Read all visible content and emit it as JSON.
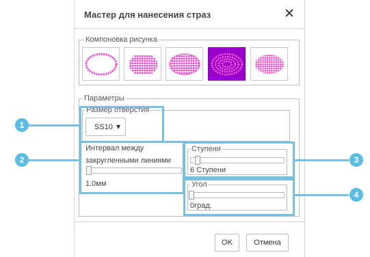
{
  "dialog": {
    "title": "Мастер для нанесения страз",
    "close_label": "✕"
  },
  "layout_group": {
    "legend": "Компоновка рисунка",
    "selected_index": 3,
    "thumbnails": [
      {
        "name": "outline-oval"
      },
      {
        "name": "filled-rounded"
      },
      {
        "name": "filled-oval-offset"
      },
      {
        "name": "concentric-oval"
      },
      {
        "name": "filled-oval-dense"
      }
    ]
  },
  "params_group": {
    "legend": "Параметры",
    "hole_size": {
      "legend": "Размер отверстия",
      "selected": "SS10"
    },
    "interval": {
      "label_line1": "Интервал между",
      "label_line2": "закругленными линиями",
      "value_text": "1.0мм"
    },
    "steps": {
      "legend": "Ступени",
      "value_text": "6 Ступени"
    },
    "angle": {
      "legend": "Угол",
      "value_text": "0град."
    }
  },
  "callouts": [
    "1",
    "2",
    "3",
    "4"
  ],
  "buttons": {
    "ok": "OK",
    "cancel": "Отмена"
  },
  "colors": {
    "accent_callout": "#73c2e3",
    "selected_thumb": "#9900cc",
    "rhinestone": "#ff33cc"
  }
}
